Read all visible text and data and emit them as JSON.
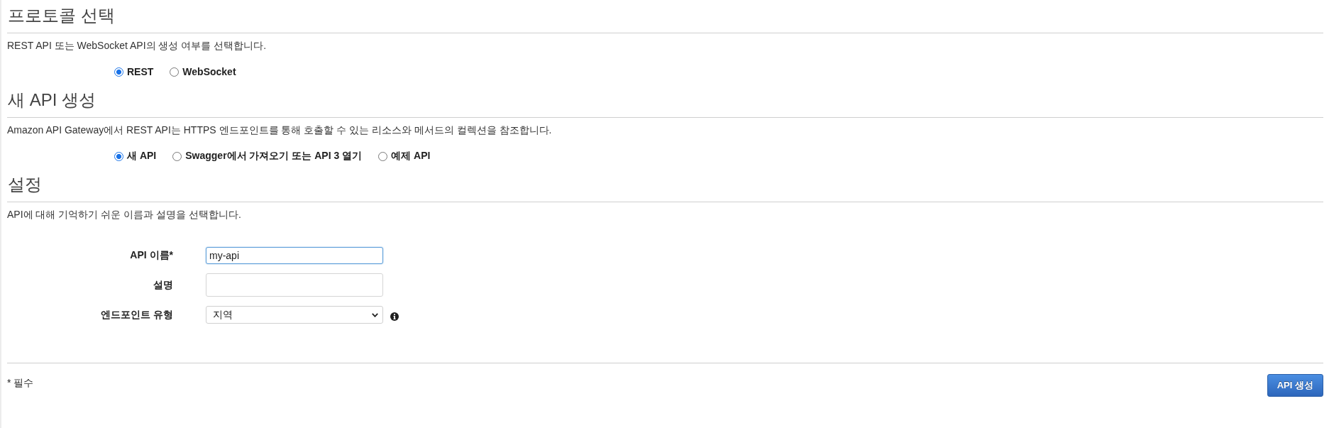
{
  "sections": [
    {
      "kind": "radio",
      "heading": "프로토콜 선택",
      "description": "REST API 또는 WebSocket API의 생성 여부를 선택합니다.",
      "options": [
        {
          "label": "REST",
          "selected": true
        },
        {
          "label": "WebSocket",
          "selected": false
        }
      ]
    },
    {
      "kind": "radio",
      "heading": "새 API 생성",
      "description": "Amazon API Gateway에서 REST API는 HTTPS 엔드포인트를 통해 호출할 수 있는 리소스와 메서드의 컬렉션을 참조합니다.",
      "options": [
        {
          "label": "새 API",
          "selected": true
        },
        {
          "label": "Swagger에서 가져오기 또는 API 3 열기",
          "selected": false
        },
        {
          "label": "예제 API",
          "selected": false
        }
      ]
    },
    {
      "kind": "form",
      "heading": "설정",
      "description": "API에 대해 기억하기 쉬운 이름과 설명을 선택합니다.",
      "fields": [
        {
          "kind": "text",
          "label": "API 이름*",
          "value": "my-api",
          "focused": true
        },
        {
          "kind": "textarea",
          "label": "설명",
          "focused": false
        },
        {
          "kind": "select",
          "label": "엔드포인트 유형",
          "value": "지역",
          "focused": false,
          "info_icon": true
        }
      ]
    }
  ],
  "footer": {
    "note": "* 필수",
    "button": "API 생성"
  }
}
